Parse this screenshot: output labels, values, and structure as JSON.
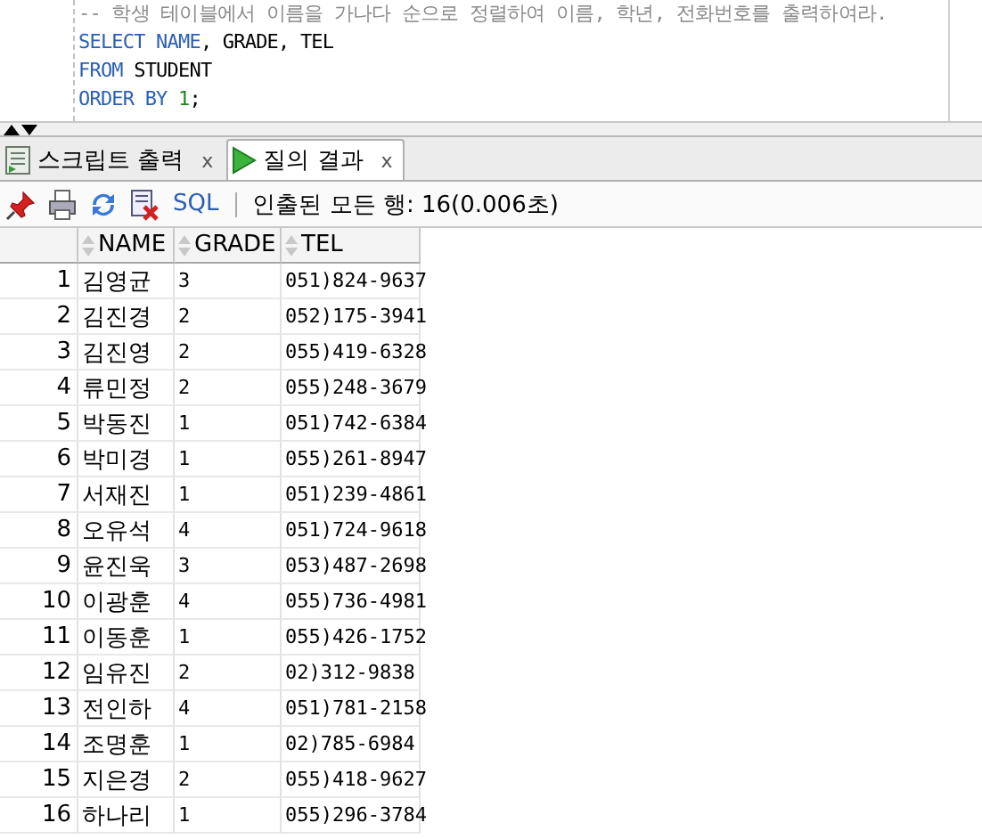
{
  "editor": {
    "lines": [
      [
        {
          "kind": "comment",
          "text": "-- 학생 테이블에서 이름을 가나다 순으로 정렬하여 이름, 학년, 전화번호를 출력하여라."
        }
      ],
      [
        {
          "kind": "keyword",
          "text": "SELECT NAME"
        },
        {
          "kind": "plain",
          "text": ", GRADE, TEL"
        }
      ],
      [
        {
          "kind": "keyword",
          "text": "FROM"
        },
        {
          "kind": "plain",
          "text": " STUDENT"
        }
      ],
      [
        {
          "kind": "keyword",
          "text": "ORDER BY "
        },
        {
          "kind": "number",
          "text": "1"
        },
        {
          "kind": "plain",
          "text": ";"
        }
      ]
    ]
  },
  "tabs": [
    {
      "label": "스크립트 출력",
      "close": "x",
      "selected": false,
      "kind": "script"
    },
    {
      "label": "질의 결과",
      "close": "x",
      "selected": true,
      "kind": "run"
    }
  ],
  "toolbar": {
    "sql_link": "SQL",
    "status": "인출된 모든 행: 16(0.006초)"
  },
  "table": {
    "columns": [
      "",
      "NAME",
      "GRADE",
      "TEL"
    ],
    "rows": [
      [
        "1",
        "김영균",
        "3",
        "051)824-9637"
      ],
      [
        "2",
        "김진경",
        "2",
        "052)175-3941"
      ],
      [
        "3",
        "김진영",
        "2",
        "055)419-6328"
      ],
      [
        "4",
        "류민정",
        "2",
        "055)248-3679"
      ],
      [
        "5",
        "박동진",
        "1",
        "051)742-6384"
      ],
      [
        "6",
        "박미경",
        "1",
        "055)261-8947"
      ],
      [
        "7",
        "서재진",
        "1",
        "051)239-4861"
      ],
      [
        "8",
        "오유석",
        "4",
        "051)724-9618"
      ],
      [
        "9",
        "윤진욱",
        "3",
        "053)487-2698"
      ],
      [
        "10",
        "이광훈",
        "4",
        "055)736-4981"
      ],
      [
        "11",
        "이동훈",
        "1",
        "055)426-1752"
      ],
      [
        "12",
        "임유진",
        "2",
        "02)312-9838"
      ],
      [
        "13",
        "전인하",
        "4",
        "051)781-2158"
      ],
      [
        "14",
        "조명훈",
        "1",
        "02)785-6984"
      ],
      [
        "15",
        "지은경",
        "2",
        "055)418-9627"
      ],
      [
        "16",
        "하나리",
        "1",
        "055)296-3784"
      ]
    ]
  }
}
